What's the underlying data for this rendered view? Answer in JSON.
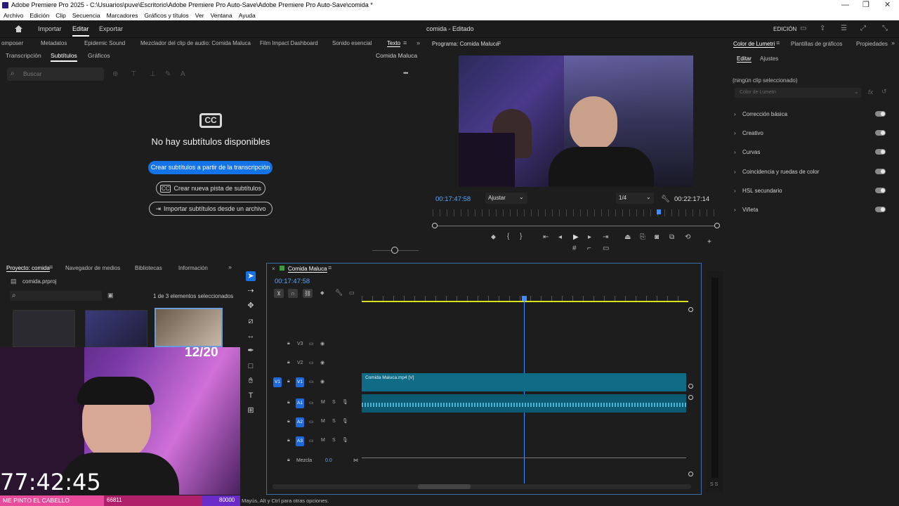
{
  "window": {
    "title": "Adobe Premiere Pro 2025 - C:\\Usuarios\\puve\\Escritorio\\Adobe Premiere Pro Auto-Save\\Adobe Premiere Pro Auto-Save\\comida *",
    "minimize": "—",
    "maximize": "❐",
    "close": "✕"
  },
  "menu": [
    "Archivo",
    "Edición",
    "Clip",
    "Secuencia",
    "Marcadores",
    "Gráficos y títulos",
    "Ver",
    "Ventana",
    "Ayuda"
  ],
  "header": {
    "home_icon": "home-icon",
    "import": "Importar",
    "edit": "Editar",
    "export": "Exportar",
    "doc_title": "comida - Editado",
    "workspace": "EDICIÓN"
  },
  "top_tabs": [
    "omposer",
    "Metadatos",
    "Epidemic Sound",
    "Mezclador del clip de audio: Comida Maluca",
    "Film Impact Dashboard",
    "Sonido esencial",
    "Texto"
  ],
  "text_panel": {
    "subtabs": [
      "Transcripción",
      "Subtítulos",
      "Gráficos"
    ],
    "sequence_name": "Comida Maluca",
    "search_placeholder": "Buscar",
    "cc_label": "CC",
    "empty_title": "No hay subtítulos disponibles",
    "btn_create_from_transcript": "Crear subtítulos a partir de la transcripción",
    "btn_new_track": "Crear nueva pista de subtítulos",
    "btn_import": "Importar subtítulos desde un archivo",
    "more_icon": "•••"
  },
  "program": {
    "title": "Programa: Comida Maluca",
    "timecode": "00:17:47:58",
    "fit": "Ajustar",
    "resolution": "1/4",
    "duration": "00:22:17:14"
  },
  "lumetri": {
    "tabs": [
      "Color de Lumetri",
      "Plantillas de gráficos",
      "Propiedades"
    ],
    "subtabs": [
      "Editar",
      "Ajustes"
    ],
    "no_clip": "(ningún clip seleccionado)",
    "dropdown": "Color de Lumetri",
    "sections": [
      "Corrección básica",
      "Creativo",
      "Curvas",
      "Coincidencia y ruedas de color",
      "HSL secundario",
      "Viñeta"
    ]
  },
  "project": {
    "tabs": [
      "Proyecto: comida",
      "Navegador de medios",
      "Bibliotecas",
      "Información"
    ],
    "file": "comida.prproj",
    "selection": "1 de 3 elementos seleccionados"
  },
  "timeline": {
    "title": "Comida Maluca",
    "timecode": "00:17:47:58",
    "tracks": [
      "V3",
      "V2",
      "V1",
      "A1",
      "A2",
      "A3"
    ],
    "clip_video": "Comida Maluca.mp4 [V]",
    "mix_label": "Mezcla",
    "mix_value": "0.0",
    "source_v1": "V1",
    "meter_label": "S S"
  },
  "status": {
    "hint": "Mayús, Alt y Ctrl para otras opciones."
  },
  "overlay": {
    "counter": "12/20",
    "clock": "77:42:45",
    "ticker_text": "ME PINTO EL CABELLO",
    "ticker_value1": "66811",
    "ticker_value2": "80000"
  },
  "colors": {
    "accent_blue": "#1473e6",
    "timeline_clip": "#0f6b86",
    "audio_wave": "#4bb4d8",
    "work_area": "#d9e020",
    "ticker_pink": "#e84a9c",
    "ticker_purple": "#6a2cc8"
  }
}
